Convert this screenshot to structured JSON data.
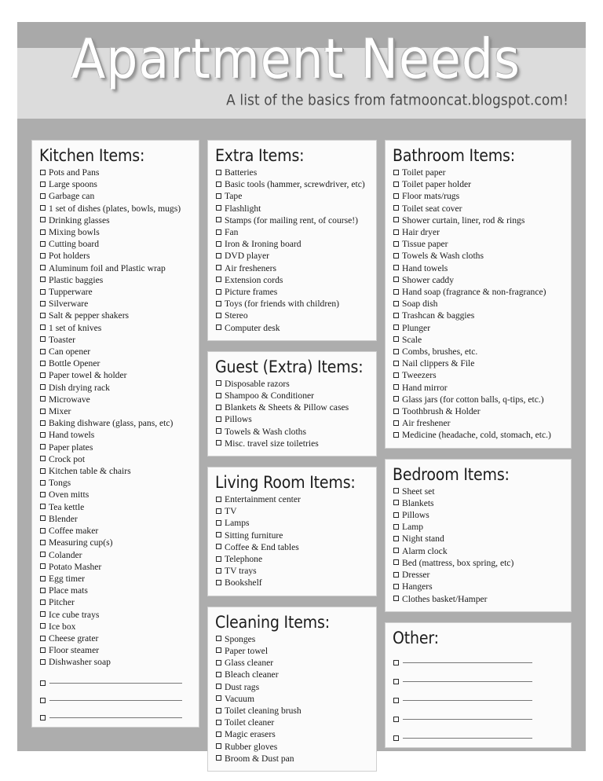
{
  "header": {
    "title": "Apartment Needs",
    "subtitle": "A list of the basics from fatmooncat.blogspot.com!"
  },
  "colors": {
    "page_background": "#ffffff",
    "sheet_background": "#adadad",
    "header_band_dark": "#a9a9a9",
    "header_band_light": "#dcdcdc",
    "card_background": "#fbfbfb",
    "card_border": "#cfcfcf",
    "title_text": "#ffffff",
    "body_text": "#1a1a1a"
  },
  "columns": [
    {
      "name": "left-column",
      "cards": [
        {
          "title": "Kitchen Items:",
          "items": [
            "Pots and Pans",
            "Large spoons",
            "Garbage can",
            "1 set of dishes (plates, bowls, mugs)",
            "Drinking glasses",
            "Mixing bowls",
            "Cutting board",
            "Pot holders",
            "Aluminum foil and Plastic wrap",
            "Plastic baggies",
            "Tupperware",
            "Silverware",
            "Salt & pepper shakers",
            "1 set of knives",
            "Toaster",
            "Can opener",
            "Bottle Opener",
            "Paper towel & holder",
            "Dish drying rack",
            "Microwave",
            "Mixer",
            "Baking dishware (glass, pans, etc)",
            "Hand towels",
            "Paper plates",
            "Crock pot",
            "Kitchen table & chairs",
            "Tongs",
            "Oven mitts",
            "Tea kettle",
            "Blender",
            "Coffee maker",
            "Measuring cup(s)",
            "Colander",
            "Potato Masher",
            "Egg timer",
            "Place mats",
            "Pitcher",
            "Ice cube trays",
            "Ice box",
            "Cheese grater",
            "Floor steamer",
            "Dishwasher soap"
          ],
          "blank_lines": 3
        }
      ]
    },
    {
      "name": "middle-column",
      "cards": [
        {
          "title": "Extra Items:",
          "items": [
            "Batteries",
            "Basic tools (hammer, screwdriver, etc)",
            "Tape",
            "Flashlight",
            "Stamps (for mailing rent, of course!)",
            "Fan",
            "Iron & Ironing board",
            "DVD player",
            "Air fresheners",
            "Extension cords",
            "Picture frames",
            "Toys (for friends with children)",
            "Stereo",
            "Computer desk"
          ],
          "blank_lines": 0
        },
        {
          "title": "Guest (Extra) Items:",
          "items": [
            "Disposable razors",
            "Shampoo & Conditioner",
            "Blankets & Sheets & Pillow cases",
            "Pillows",
            "Towels & Wash cloths",
            "Misc. travel size toiletries"
          ],
          "blank_lines": 0
        },
        {
          "title": "Living Room Items:",
          "items": [
            "Entertainment center",
            "TV",
            "Lamps",
            "Sitting furniture",
            "Coffee & End tables",
            "Telephone",
            "TV trays",
            "Bookshelf"
          ],
          "blank_lines": 0
        },
        {
          "title": "Cleaning Items:",
          "items": [
            "Sponges",
            "Paper towel",
            "Glass cleaner",
            "Bleach cleaner",
            "Dust rags",
            "Vacuum",
            "Toilet cleaning brush",
            "Toilet cleaner",
            "Magic erasers",
            "Rubber gloves",
            "Broom & Dust pan"
          ],
          "blank_lines": 0
        }
      ]
    },
    {
      "name": "right-column",
      "cards": [
        {
          "title": "Bathroom Items:",
          "items": [
            "Toilet paper",
            "Toilet paper holder",
            "Floor mats/rugs",
            "Toilet seat cover",
            "Shower curtain, liner, rod & rings",
            "Hair dryer",
            "Tissue paper",
            "Towels & Wash cloths",
            "Hand towels",
            "Shower caddy",
            "Hand soap (fragrance & non-fragrance)",
            "Soap dish",
            "Trashcan & baggies",
            "Plunger",
            "Scale",
            "Combs, brushes, etc.",
            "Nail clippers & File",
            "Tweezers",
            "Hand mirror",
            "Glass jars (for cotton balls, q-tips, etc.)",
            "Toothbrush & Holder",
            "Air freshener",
            "Medicine (headache, cold, stomach, etc.)"
          ],
          "blank_lines": 0
        },
        {
          "title": "Bedroom Items:",
          "items": [
            "Sheet set",
            "Blankets",
            "Pillows",
            "Lamp",
            "Night stand",
            "Alarm clock",
            "Bed (mattress, box spring, etc)",
            "Dresser",
            "Hangers",
            "Clothes basket/Hamper"
          ],
          "blank_lines": 0
        },
        {
          "title": "Other:",
          "items": [],
          "blank_lines": 5
        }
      ]
    }
  ]
}
